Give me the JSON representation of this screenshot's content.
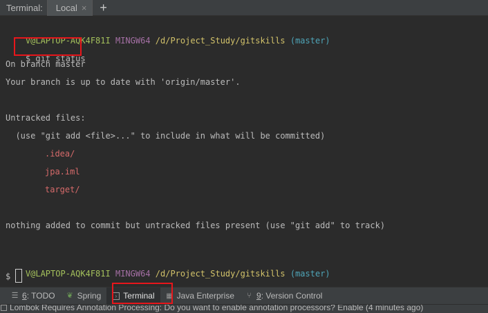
{
  "header": {
    "title": "Terminal:",
    "tab_label": "Local",
    "close_glyph": "×",
    "add_glyph": "+"
  },
  "terminal": {
    "prompt1": {
      "user": "V@LAPTOP-AQK4F81I",
      "env": "MINGW64",
      "path": "/d/Project_Study/gitskills",
      "branch": "(master)"
    },
    "command_prefix": "$",
    "command": "git status",
    "lines": [
      "On branch master",
      "Your branch is up to date with 'origin/master'.",
      "Untracked files:",
      "  (use \"git add <file>...\" to include in what will be committed)"
    ],
    "untracked": [
      ".idea/",
      "jpa.iml",
      "target/"
    ],
    "summary": "nothing added to commit but untracked files present (use \"git add\" to track)",
    "prompt2": {
      "user": "V@LAPTOP-AQK4F81I",
      "env": "MINGW64",
      "path": "/d/Project_Study/gitskills",
      "branch": "(master)"
    },
    "prompt_symbol": "$"
  },
  "toolwindows": [
    {
      "key": "6",
      "label": ": TODO",
      "icon": "list-icon"
    },
    {
      "key": "",
      "label": "Spring",
      "icon": "spring-leaf-icon"
    },
    {
      "key": "",
      "label": "Terminal",
      "icon": "terminal-icon",
      "active": true
    },
    {
      "key": "",
      "label": "Java Enterprise",
      "icon": "java-enterprise-icon"
    },
    {
      "key": "9",
      "label": ": Version Control",
      "icon": "vcs-icon"
    }
  ],
  "status": {
    "message": "Lombok Requires Annotation Processing: Do you want to enable annotation processors? Enable (4 minutes ago)"
  },
  "colors": {
    "highlight_box": "#e8161b",
    "user": "#a5c25c",
    "env": "#a570a5",
    "path": "#d2c26a",
    "branch": "#4fa5b8",
    "untracked": "#d66a6a"
  }
}
